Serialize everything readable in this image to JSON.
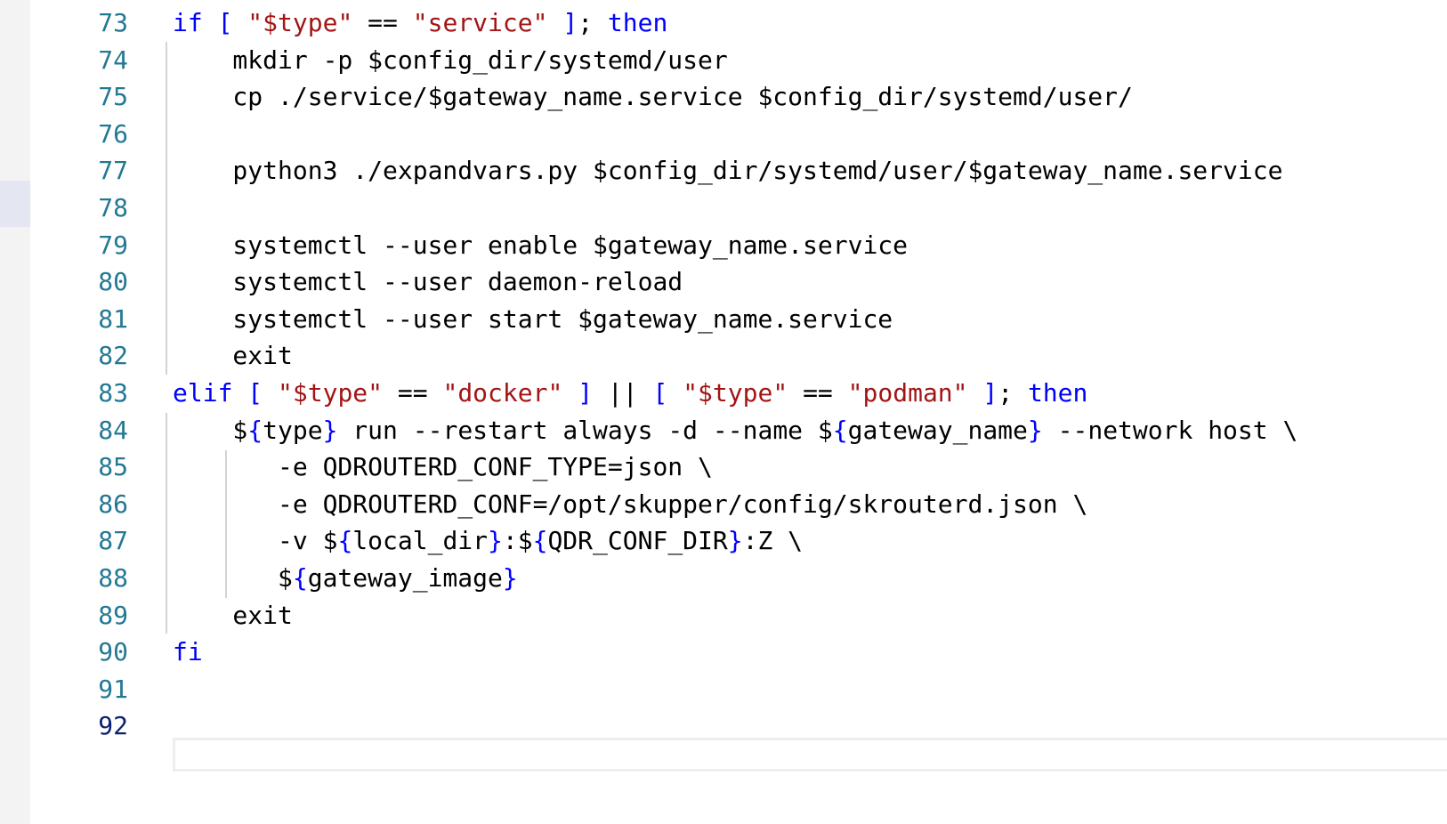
{
  "editor": {
    "colors": {
      "keyword": "#0000ff",
      "string": "#a31515",
      "text": "#000000",
      "line_number": "#237893",
      "active_line_number": "#0b216f"
    },
    "active_line": "92",
    "lines": [
      {
        "number": "73",
        "tokens": [
          {
            "t": "if",
            "c": "kw"
          },
          {
            "t": " ",
            "c": "plain"
          },
          {
            "t": "[",
            "c": "kw"
          },
          {
            "t": " ",
            "c": "plain"
          },
          {
            "t": "\"$type\"",
            "c": "str"
          },
          {
            "t": " == ",
            "c": "plain"
          },
          {
            "t": "\"service\"",
            "c": "str"
          },
          {
            "t": " ",
            "c": "plain"
          },
          {
            "t": "]",
            "c": "kw"
          },
          {
            "t": "; ",
            "c": "plain"
          },
          {
            "t": "then",
            "c": "kw"
          }
        ]
      },
      {
        "number": "74",
        "tokens": [
          {
            "t": "    mkdir -p $config_dir/systemd/user",
            "c": "plain"
          }
        ]
      },
      {
        "number": "75",
        "tokens": [
          {
            "t": "    cp ./service/$gateway_name.service $config_dir/systemd/user/",
            "c": "plain"
          }
        ]
      },
      {
        "number": "76",
        "tokens": []
      },
      {
        "number": "77",
        "tokens": [
          {
            "t": "    python3 ./expandvars.py $config_dir/systemd/user/$gateway_name.service",
            "c": "plain"
          }
        ]
      },
      {
        "number": "78",
        "tokens": []
      },
      {
        "number": "79",
        "tokens": [
          {
            "t": "    systemctl --user enable $gateway_name.service",
            "c": "plain"
          }
        ]
      },
      {
        "number": "80",
        "tokens": [
          {
            "t": "    systemctl --user daemon-reload",
            "c": "plain"
          }
        ]
      },
      {
        "number": "81",
        "tokens": [
          {
            "t": "    systemctl --user start $gateway_name.service",
            "c": "plain"
          }
        ]
      },
      {
        "number": "82",
        "tokens": [
          {
            "t": "    exit",
            "c": "plain"
          }
        ]
      },
      {
        "number": "83",
        "tokens": [
          {
            "t": "elif",
            "c": "kw"
          },
          {
            "t": " ",
            "c": "plain"
          },
          {
            "t": "[",
            "c": "kw"
          },
          {
            "t": " ",
            "c": "plain"
          },
          {
            "t": "\"$type\"",
            "c": "str"
          },
          {
            "t": " == ",
            "c": "plain"
          },
          {
            "t": "\"docker\"",
            "c": "str"
          },
          {
            "t": " ",
            "c": "plain"
          },
          {
            "t": "]",
            "c": "kw"
          },
          {
            "t": " || ",
            "c": "plain"
          },
          {
            "t": "[",
            "c": "kw"
          },
          {
            "t": " ",
            "c": "plain"
          },
          {
            "t": "\"$type\"",
            "c": "str"
          },
          {
            "t": " == ",
            "c": "plain"
          },
          {
            "t": "\"podman\"",
            "c": "str"
          },
          {
            "t": " ",
            "c": "plain"
          },
          {
            "t": "]",
            "c": "kw"
          },
          {
            "t": "; ",
            "c": "plain"
          },
          {
            "t": "then",
            "c": "kw"
          }
        ]
      },
      {
        "number": "84",
        "tokens": [
          {
            "t": "    $",
            "c": "plain"
          },
          {
            "t": "{",
            "c": "kw"
          },
          {
            "t": "type",
            "c": "plain"
          },
          {
            "t": "}",
            "c": "kw"
          },
          {
            "t": " run --restart always -d --name $",
            "c": "plain"
          },
          {
            "t": "{",
            "c": "kw"
          },
          {
            "t": "gateway_name",
            "c": "plain"
          },
          {
            "t": "}",
            "c": "kw"
          },
          {
            "t": " --network host \\",
            "c": "plain"
          }
        ]
      },
      {
        "number": "85",
        "tokens": [
          {
            "t": "       -e QDROUTERD_CONF_TYPE=json \\",
            "c": "plain"
          }
        ]
      },
      {
        "number": "86",
        "tokens": [
          {
            "t": "       -e QDROUTERD_CONF=/opt/skupper/config/skrouterd.json \\",
            "c": "plain"
          }
        ]
      },
      {
        "number": "87",
        "tokens": [
          {
            "t": "       -v $",
            "c": "plain"
          },
          {
            "t": "{",
            "c": "kw"
          },
          {
            "t": "local_dir",
            "c": "plain"
          },
          {
            "t": "}",
            "c": "kw"
          },
          {
            "t": ":$",
            "c": "plain"
          },
          {
            "t": "{",
            "c": "kw"
          },
          {
            "t": "QDR_CONF_DIR",
            "c": "plain"
          },
          {
            "t": "}",
            "c": "kw"
          },
          {
            "t": ":Z \\",
            "c": "plain"
          }
        ]
      },
      {
        "number": "88",
        "tokens": [
          {
            "t": "       $",
            "c": "plain"
          },
          {
            "t": "{",
            "c": "kw"
          },
          {
            "t": "gateway_image",
            "c": "plain"
          },
          {
            "t": "}",
            "c": "kw"
          }
        ]
      },
      {
        "number": "89",
        "tokens": [
          {
            "t": "    exit",
            "c": "plain"
          }
        ]
      },
      {
        "number": "90",
        "tokens": [
          {
            "t": "fi",
            "c": "kw"
          }
        ]
      },
      {
        "number": "91",
        "tokens": []
      },
      {
        "number": "92",
        "tokens": []
      }
    ]
  }
}
